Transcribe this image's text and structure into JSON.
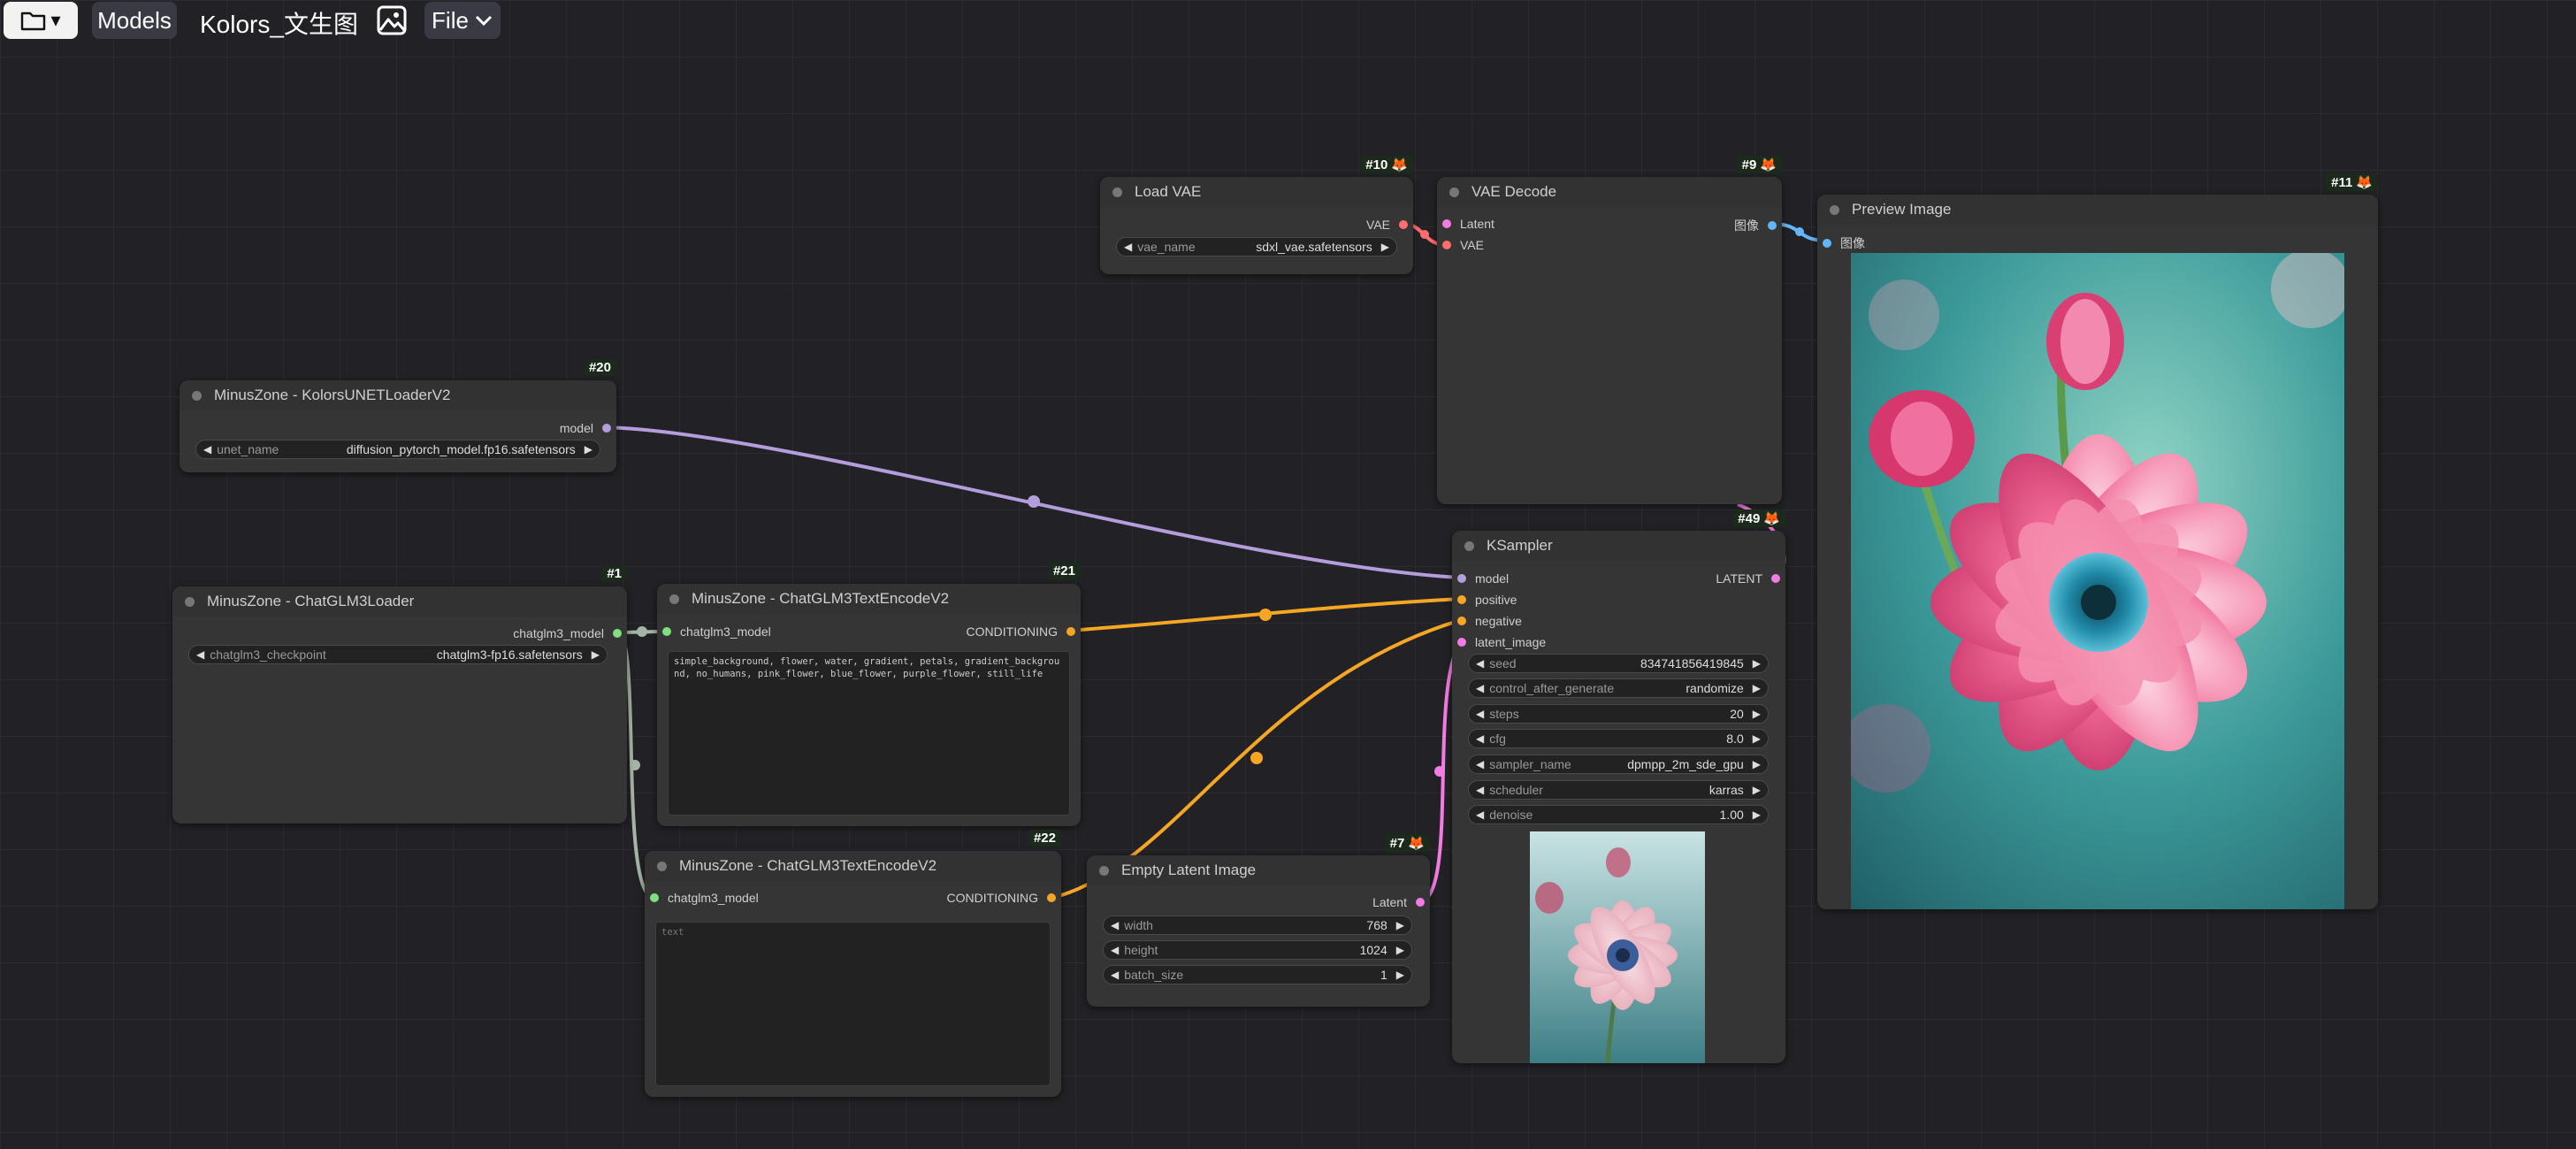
{
  "topbar": {
    "folder_icon": "folder-icon",
    "caret": "▾",
    "models_label": "Models",
    "workflow_title": "Kolors_文生图",
    "image_icon": "image-icon",
    "file_label": "File"
  },
  "colors": {
    "canvas": "#222226",
    "node_bg": "#353535",
    "model_wire": "#b39ddb",
    "conditioning_wire": "#f5a623",
    "latent_wire": "#f27ce3",
    "vae_wire": "#ff6e6e",
    "image_wire": "#64b5f6",
    "chatglm_wire": "#a5b5a5"
  },
  "nodes": {
    "load_vae": {
      "id": "#10",
      "title": "Load VAE",
      "output": "VAE",
      "widget": {
        "label": "vae_name",
        "value": "sdxl_vae.safetensors"
      }
    },
    "vae_decode": {
      "id": "#9",
      "title": "VAE Decode",
      "inputs": [
        "Latent",
        "VAE"
      ],
      "output": "图像"
    },
    "preview_image": {
      "id": "#11",
      "title": "Preview Image",
      "input": "图像"
    },
    "unet_loader": {
      "id": "#20",
      "title": "MinusZone - KolorsUNETLoaderV2",
      "output": "model",
      "widget": {
        "label": "unet_name",
        "value": "diffusion_pytorch_model.fp16.safetensors"
      }
    },
    "glm_loader": {
      "id": "#1",
      "title": "MinusZone - ChatGLM3Loader",
      "output": "chatglm3_model",
      "widget": {
        "label": "chatglm3_checkpoint",
        "value": "chatglm3-fp16.safetensors"
      }
    },
    "text_encode_pos": {
      "id": "#21",
      "title": "MinusZone - ChatGLM3TextEncodeV2",
      "input": "chatglm3_model",
      "output": "CONDITIONING",
      "text": "simple_background, flower, water, gradient, petals, gradient_background, no_humans, pink_flower, blue_flower, purple_flower, still_life"
    },
    "text_encode_neg": {
      "id": "#22",
      "title": "MinusZone - ChatGLM3TextEncodeV2",
      "input": "chatglm3_model",
      "output": "CONDITIONING",
      "placeholder": "text"
    },
    "empty_latent": {
      "id": "#7",
      "title": "Empty Latent Image",
      "output": "Latent",
      "widgets": [
        {
          "label": "width",
          "value": "768"
        },
        {
          "label": "height",
          "value": "1024"
        },
        {
          "label": "batch_size",
          "value": "1"
        }
      ]
    },
    "ksampler": {
      "id": "#49",
      "title": "KSampler",
      "inputs": [
        "model",
        "positive",
        "negative",
        "latent_image"
      ],
      "output": "LATENT",
      "widgets": [
        {
          "label": "seed",
          "value": "834741856419845"
        },
        {
          "label": "control_after_generate",
          "value": "randomize"
        },
        {
          "label": "steps",
          "value": "20"
        },
        {
          "label": "cfg",
          "value": "8.0"
        },
        {
          "label": "sampler_name",
          "value": "dpmpp_2m_sde_gpu"
        },
        {
          "label": "scheduler",
          "value": "karras"
        },
        {
          "label": "denoise",
          "value": "1.00"
        }
      ]
    }
  }
}
